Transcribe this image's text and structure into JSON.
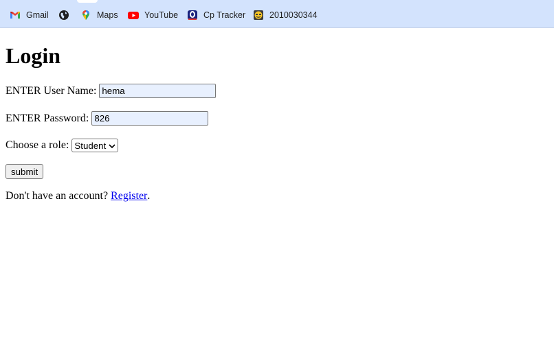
{
  "bookmarks": [
    {
      "label": "Gmail",
      "icon": "gmail-icon"
    },
    {
      "label": "",
      "icon": "globe-icon"
    },
    {
      "label": "Maps",
      "icon": "maps-icon"
    },
    {
      "label": "YouTube",
      "icon": "youtube-icon"
    },
    {
      "label": "Cp Tracker",
      "icon": "cp-tracker-icon"
    },
    {
      "label": "2010030344",
      "icon": "smiley-icon"
    }
  ],
  "form": {
    "title": "Login",
    "username_label": "ENTER User Name:",
    "username_value": "hema",
    "password_label": "ENTER Password:",
    "password_value": "826",
    "role_label": "Choose a role:",
    "role_selected": "Student",
    "submit_label": "submit",
    "register_prefix": "Don't have an account?",
    "register_link": "Register",
    "register_suffix": "."
  },
  "colors": {
    "bookmarks_bar": "#d3e3fd",
    "autofill": "#e8f0fe",
    "link": "#0000ee"
  }
}
